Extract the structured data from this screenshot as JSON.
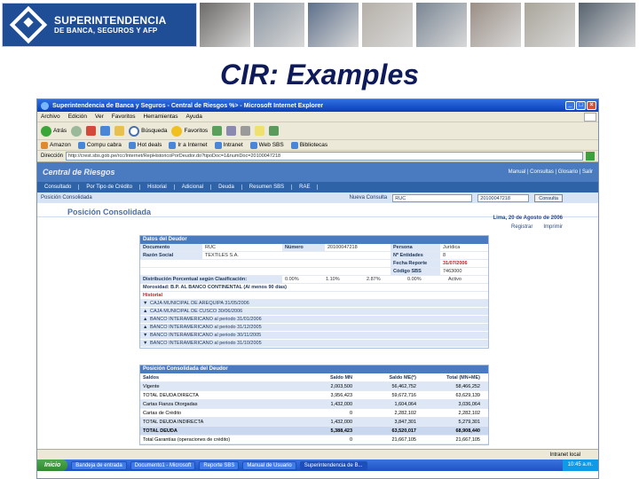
{
  "banner": {
    "logo_line1": "SUPERINTENDENCIA",
    "logo_line2": "DE BANCA, SEGUROS Y AFP",
    "photo_colors": [
      "#6d6a68",
      "#8c97a3",
      "#5d6f8a",
      "#b5b0a8",
      "#7a8694",
      "#9b8f86",
      "#a9a59a",
      "#56626f"
    ]
  },
  "slide": {
    "title": "CIR: Examples"
  },
  "browser": {
    "window_title": "Superintendencia de Banca y Seguros - Central de Riesgos %> - Microsoft Internet Explorer",
    "menu": [
      "Archivo",
      "Edición",
      "Ver",
      "Favoritos",
      "Herramientas",
      "Ayuda"
    ],
    "toolbar": {
      "back": "Atrás",
      "search": "Búsqueda",
      "favorites": "Favoritos"
    },
    "links": [
      "Amazon",
      "Compu cabra",
      "Hot deals",
      "Ir a Internet",
      "Intranet",
      "Web SBS",
      "Bibliotecas"
    ],
    "address_label": "Dirección",
    "address": "http://crest.sbs.gob.pe/rcc/Internet/RepHistoricoPorDeudor.do?tipoDoc=1&numDoc=20100047218",
    "status": "",
    "zone": "Intranet local"
  },
  "app": {
    "title": "Central de Riesgos",
    "top_links": "Manual | Consultas | Glosario | Salir",
    "nav": [
      "Consultado",
      "Por Tipo de Crédito",
      "Historial",
      "Adicional",
      "Deuda",
      "Resumen SBS",
      "RAE"
    ],
    "breadcrumb": "Posición Consolidada",
    "nueva_consulta_label": "Nueva Consulta",
    "select_value": "RUC",
    "select2_value": "20100047218",
    "consulta_button": "Consulta",
    "heading": "Posición Consolidada",
    "date": "Lima, 20 de Agosto de 2006",
    "action_register": "Registrar",
    "action_print": "Imprimir"
  },
  "datos": {
    "header": "Datos del Deudor",
    "rows": [
      {
        "l1": "Documento",
        "v1": "RUC",
        "l2": "Número",
        "v2": "20100047218",
        "l3": "Persona",
        "v3": "Jurídica"
      },
      {
        "l1": "Razón Social",
        "v1": "TEXTILES S.A.",
        "l2": "",
        "v2": "",
        "l3": "Nº Entidades",
        "v3": "8"
      },
      {
        "l1": "",
        "v1": "",
        "l2": "",
        "v2": "",
        "l3": "Fecha Reporte",
        "v3": "31/07/2006"
      },
      {
        "l1": "",
        "v1": "",
        "l2": "",
        "v2": "",
        "l3": "Código SBS",
        "v3": "7463000"
      }
    ],
    "distribution_label": "Distribución Porcentual según Clasificación:",
    "distribution_values": [
      "0.00%",
      "1.10%",
      "2.87%",
      "0.00%",
      "Activo"
    ],
    "morosidad": "Morosidad: B.P.  AL BANCO CONTINENTAL (Al menos 90 días)",
    "historial_label": "Historial",
    "historial": [
      "CAJA MUNICIPAL DE AREQUIPA 31/05/2006",
      "CAJA MUNICIPAL DE CUSCO 30/06/2006",
      "BANCO INTERAMERICANO al periodo 31/01/2006",
      "BANCO INTERAMERICANO al periodo 31/12/2005",
      "BANCO INTERAMERICANO al periodo 30/11/2005",
      "BANCO INTERAMERICANO al periodo 31/10/2005"
    ]
  },
  "posicion": {
    "header": "Posición Consolidada del Deudor",
    "columns": [
      "Saldos",
      "Saldo MN",
      "Saldo ME(*)",
      "Total (MN+ME)"
    ],
    "rows": [
      [
        "Vigente",
        "2,003,500",
        "56,462,752",
        "58,466,252"
      ],
      [
        "TOTAL DEUDA DIRECTA",
        "3,956,423",
        "59,672,716",
        "63,629,139"
      ],
      [
        "Cartas Fianza Otorgadas",
        "1,432,000",
        "1,604,064",
        "3,036,064"
      ],
      [
        "Cartas de Crédito",
        "0",
        "2,282,102",
        "2,282,102"
      ],
      [
        "TOTAL DEUDA INDIRECTA",
        "1,432,000",
        "3,847,301",
        "5,279,301"
      ],
      [
        "TOTAL DEUDA",
        "5,388,423",
        "63,520,017",
        "68,908,440"
      ],
      [
        "Total Garantías (operaciones de crédito)",
        "0",
        "21,667,105",
        "21,667,105"
      ]
    ]
  },
  "taskbar": {
    "start": "Inicio",
    "tasks": [
      "Bandeja de entrada",
      "Documento1 - Microsoft",
      "Reporte SBS",
      "Manual de Usuario",
      "Superintendencia de B..."
    ],
    "clock": "10:45 a.m."
  }
}
